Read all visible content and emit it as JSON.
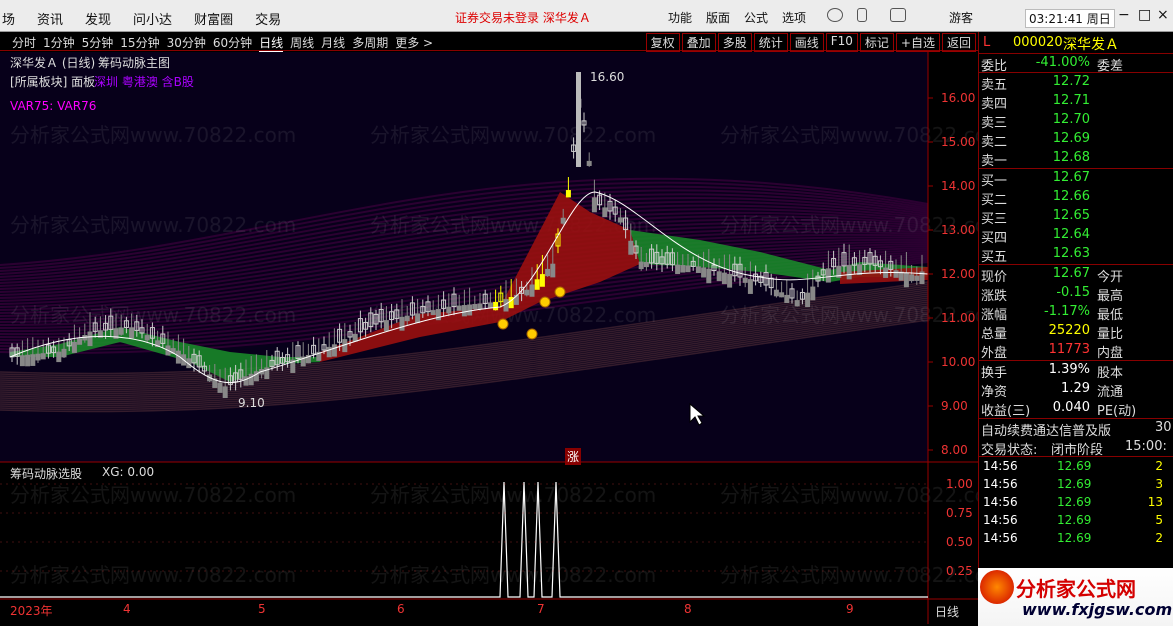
{
  "menu": [
    "场",
    "资讯",
    "发现",
    "问小达",
    "财富圈",
    "交易"
  ],
  "warn": "证券交易未登录  深华发Ａ",
  "tools": [
    "功能",
    "版面",
    "公式",
    "选项"
  ],
  "guest": "游客",
  "clock": "03:21:41 周日",
  "periods": [
    "分时",
    "1分钟",
    "5分钟",
    "15分钟",
    "30分钟",
    "60分钟",
    "日线",
    "周线",
    "月线",
    "多周期",
    "更多 >"
  ],
  "active_period": "日线",
  "actions": [
    "复权",
    "叠加",
    "多股",
    "统计",
    "画线",
    "F10",
    "标记",
    "+自选",
    "返回"
  ],
  "chart_title": "深华发Ａ (日线)",
  "main_indicator": "筹码动脉主图",
  "sector": "[所属板块] 面板",
  "sector_tags": "深圳 粤港澳 含B股",
  "var_line": "VAR75: VAR76",
  "watermark": "分析家公式网www.70822.com",
  "price_ticks": [
    "16.00",
    "15.00",
    "14.00",
    "13.00",
    "12.00",
    "11.00",
    "10.00",
    "9.00",
    "8.00"
  ],
  "high_label": "16.60",
  "low_label": "9.10",
  "badge": "涨",
  "sub_indicator": "筹码动脉选股",
  "xg_label": "XG: 0.00",
  "sub_ticks": [
    "1.00",
    "0.75",
    "0.50",
    "0.25"
  ],
  "date_labels": [
    "2023年",
    "4",
    "5",
    "6",
    "7",
    "8",
    "9"
  ],
  "bottom_tab": "日线",
  "quote": {
    "L": "L",
    "code": "000020",
    "name": "深华发Ａ",
    "weibi_k": "委比",
    "weibi_v": "-41.00%",
    "weicha": "委差",
    "asks": [
      {
        "k": "卖五",
        "v": "12.72"
      },
      {
        "k": "卖四",
        "v": "12.71"
      },
      {
        "k": "卖三",
        "v": "12.70"
      },
      {
        "k": "卖二",
        "v": "12.69"
      },
      {
        "k": "卖一",
        "v": "12.68"
      }
    ],
    "bids": [
      {
        "k": "买一",
        "v": "12.67"
      },
      {
        "k": "买二",
        "v": "12.66"
      },
      {
        "k": "买三",
        "v": "12.65"
      },
      {
        "k": "买四",
        "v": "12.64"
      },
      {
        "k": "买五",
        "v": "12.63"
      }
    ],
    "stats": [
      {
        "k": "现价",
        "v": "12.67",
        "c": "g",
        "k2": "今开"
      },
      {
        "k": "涨跌",
        "v": "-0.15",
        "c": "g",
        "k2": "最高"
      },
      {
        "k": "涨幅",
        "v": "-1.17%",
        "c": "g",
        "k2": "最低"
      },
      {
        "k": "总量",
        "v": "25220",
        "c": "y",
        "k2": "量比"
      },
      {
        "k": "外盘",
        "v": "11773",
        "c": "r",
        "k2": "内盘"
      }
    ],
    "stats2": [
      {
        "k": "换手",
        "v": "1.39%",
        "c": "w",
        "k2": "股本"
      },
      {
        "k": "净资",
        "v": "1.29",
        "c": "w",
        "k2": "流通"
      },
      {
        "k": "收益(三)",
        "v": "0.040",
        "c": "w",
        "k2": "PE(动)"
      }
    ],
    "notice": "自动续费通达信普及版",
    "notice_num": "30",
    "status_k": "交易状态:",
    "status_v": "闭市阶段",
    "status_t": "15:00:",
    "trades": [
      {
        "t": "14:56",
        "p": "12.69",
        "q": "2"
      },
      {
        "t": "14:56",
        "p": "12.69",
        "q": "3"
      },
      {
        "t": "14:56",
        "p": "12.69",
        "q": "13"
      },
      {
        "t": "14:56",
        "p": "12.69",
        "q": "5"
      },
      {
        "t": "14:56",
        "p": "12.69",
        "q": "2"
      }
    ]
  },
  "ad": {
    "title": "分析家公式网",
    "url": "www.fxjgsw.com"
  }
}
